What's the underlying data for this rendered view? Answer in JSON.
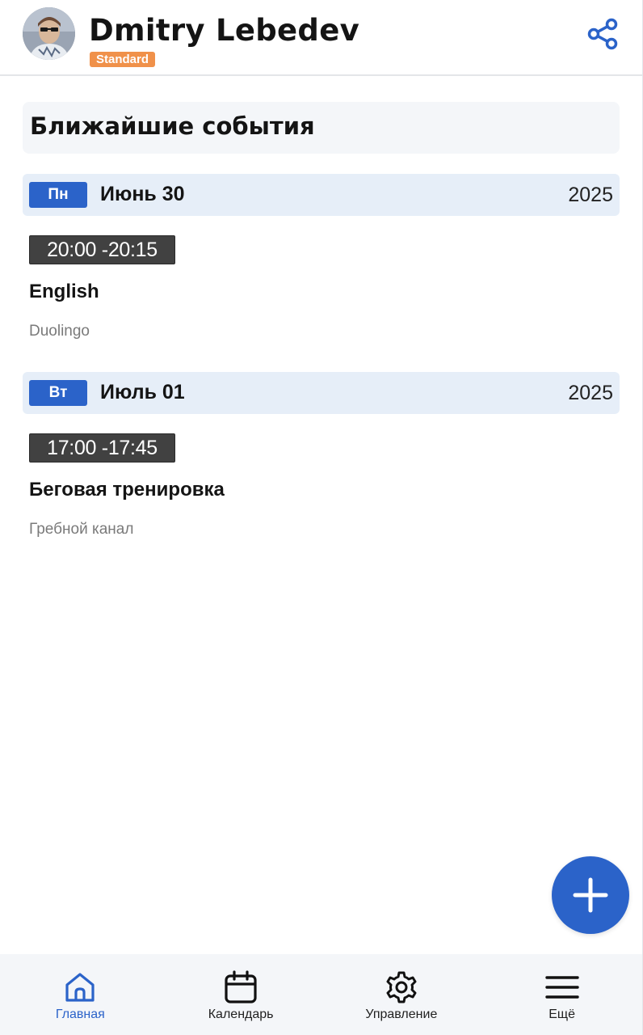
{
  "header": {
    "user_name": "Dmitry Lebedev",
    "plan_badge": "Standard",
    "avatar_icon": "user-avatar",
    "share_icon": "share-icon"
  },
  "section": {
    "title": "Ближайшие события"
  },
  "days": [
    {
      "weekday": "Пн",
      "date": "Июнь 30",
      "year": "2025",
      "events": [
        {
          "time": "20:00 -20:15",
          "title": "English",
          "subtitle": "Duolingo"
        }
      ]
    },
    {
      "weekday": "Вт",
      "date": "Июль 01",
      "year": "2025",
      "events": [
        {
          "time": "17:00 -17:45",
          "title": "Беговая тренировка",
          "subtitle": "Гребной канал"
        }
      ]
    }
  ],
  "fab": {
    "icon": "plus-icon"
  },
  "bottom_nav": {
    "items": [
      {
        "label": "Главная",
        "icon": "home-icon",
        "active": true
      },
      {
        "label": "Календарь",
        "icon": "calendar-icon",
        "active": false
      },
      {
        "label": "Управление",
        "icon": "gear-icon",
        "active": false
      },
      {
        "label": "Ещё",
        "icon": "menu-icon",
        "active": false
      }
    ]
  },
  "colors": {
    "accent": "#2b63c9",
    "badge": "#f0914a",
    "day_row_bg": "#e6eef8",
    "time_chip_bg": "#414141",
    "nav_bg": "#f4f6f9"
  }
}
